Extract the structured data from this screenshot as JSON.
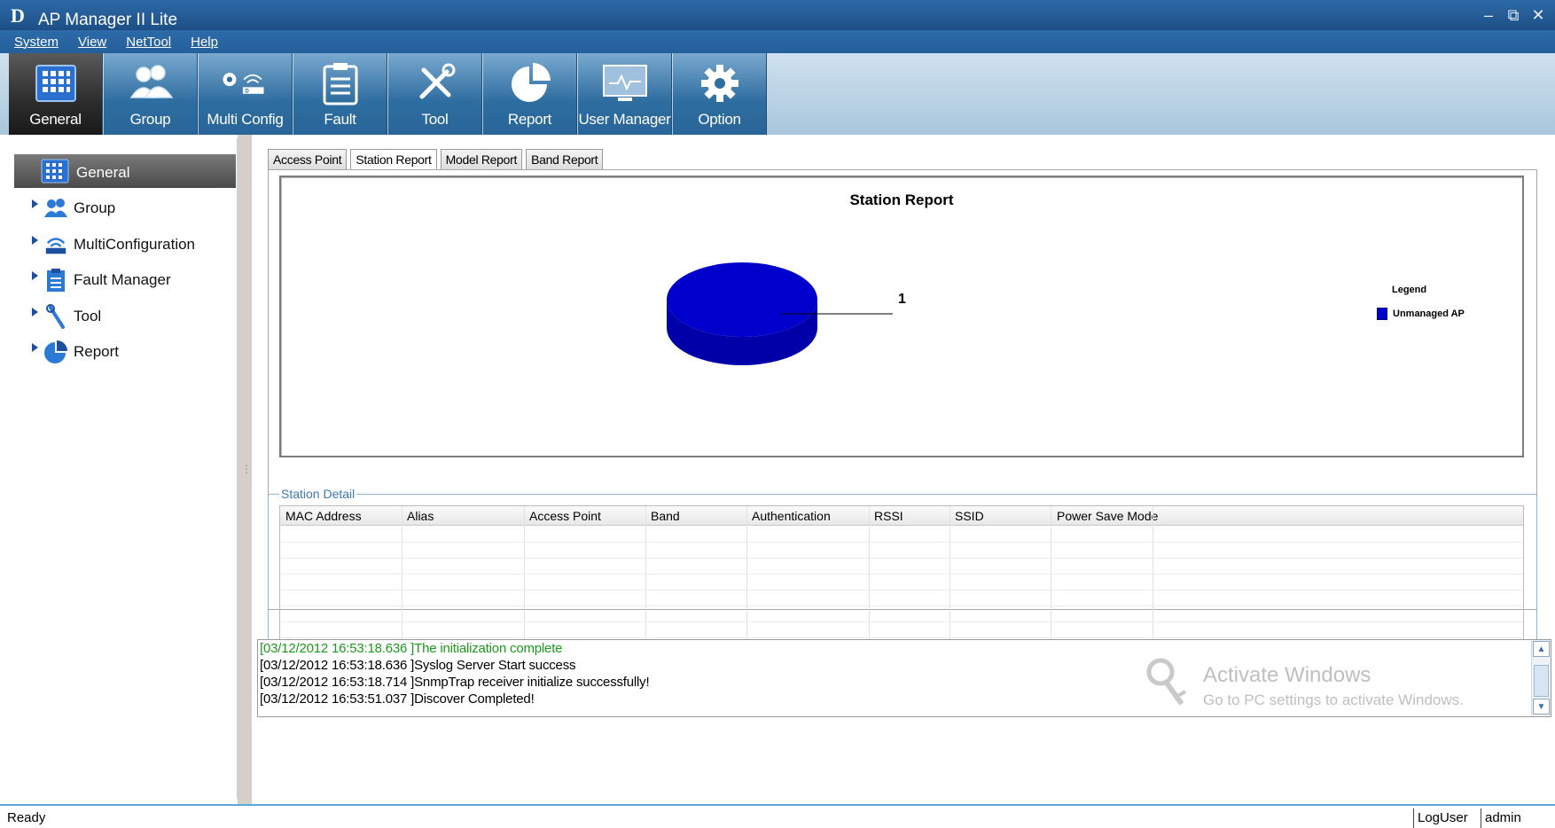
{
  "window": {
    "title": "AP Manager II Lite",
    "logo": "D"
  },
  "menu": [
    "System",
    "View",
    "NetTool",
    "Help"
  ],
  "toolbar": [
    {
      "label": "General",
      "icon": "grid-icon",
      "active": true
    },
    {
      "label": "Group",
      "icon": "users-icon"
    },
    {
      "label": "Multi Config",
      "icon": "router-config-icon"
    },
    {
      "label": "Fault",
      "icon": "clipboard-icon"
    },
    {
      "label": "Tool",
      "icon": "tools-icon"
    },
    {
      "label": "Report",
      "icon": "pie-chart-icon"
    },
    {
      "label": "User Manager",
      "icon": "monitor-icon"
    },
    {
      "label": "Option",
      "icon": "gear-icon"
    }
  ],
  "tree": {
    "selected": "General",
    "items": [
      "Group",
      "MultiConfiguration",
      "Fault Manager",
      "Tool",
      "Report"
    ]
  },
  "tabs": [
    "Access Point",
    "Station Report",
    "Model Report",
    "Band Report"
  ],
  "chart_data": {
    "type": "pie",
    "title": "Station Report",
    "categories": [
      "Unmanaged AP"
    ],
    "values": [
      1
    ],
    "data_labels": [
      "1"
    ],
    "legend_title": "Legend",
    "legend_position": "right",
    "colors": [
      "#0000cc"
    ]
  },
  "detail": {
    "legend": "Station Detail",
    "columns": [
      "MAC Address",
      "Alias",
      "Access Point",
      "Band",
      "Authentication",
      "RSSI",
      "SSID",
      "Power Save Mode"
    ]
  },
  "log": [
    {
      "text": "[03/12/2012 16:53:18.636 ]The initialization complete",
      "color": "green"
    },
    {
      "text": "[03/12/2012 16:53:18.636 ]Syslog Server Start success"
    },
    {
      "text": "[03/12/2012 16:53:18.714 ]SnmpTrap receiver initialize successfully!"
    },
    {
      "text": "[03/12/2012 16:53:51.037 ]Discover Completed!"
    }
  ],
  "watermark": {
    "line1": "Activate Windows",
    "line2": "Go to PC settings to activate Windows."
  },
  "status": {
    "ready": "Ready",
    "user_label": "LogUser",
    "user": "admin"
  },
  "colors": {
    "accent": "#2c6aa8",
    "pie": "#0000cc",
    "log_green": "#1c9a1c"
  }
}
